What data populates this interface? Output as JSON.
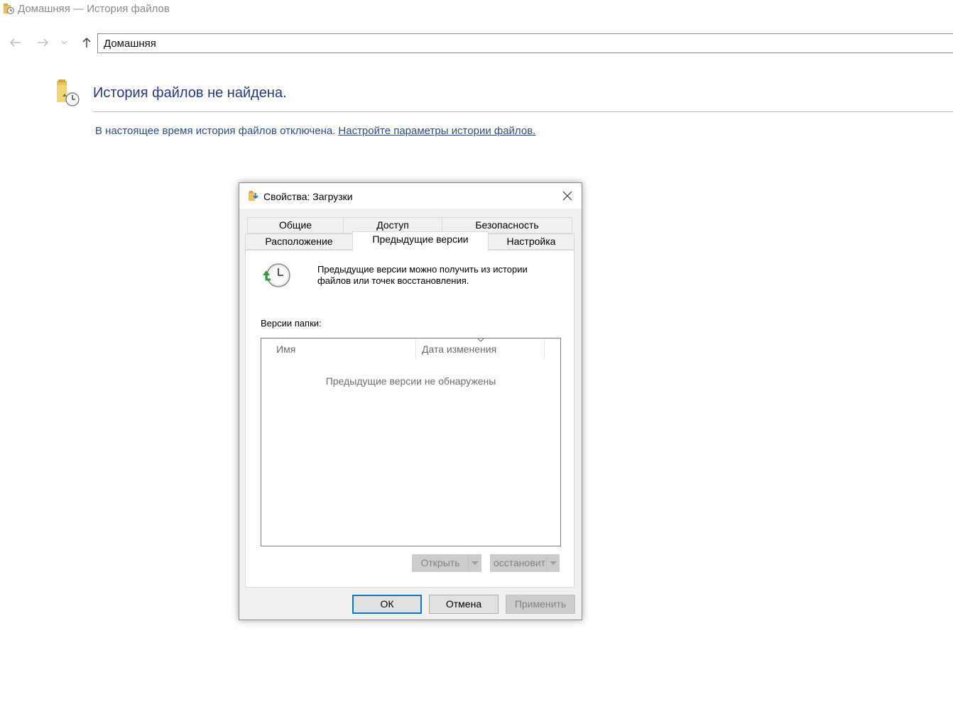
{
  "window": {
    "title": "Домашняя — История файлов"
  },
  "nav": {
    "address": "Домашняя"
  },
  "main": {
    "heading": "История файлов не найдена.",
    "info_text": "В настоящее время история файлов отключена.",
    "settings_link": "Настройте параметры истории файлов."
  },
  "dialog": {
    "title": "Свойства: Загрузки",
    "tabs_row1": [
      "Общие",
      "Доступ",
      "Безопасность"
    ],
    "tabs_row2": [
      "Расположение",
      "Предыдущие версии",
      "Настройка"
    ],
    "active_tab": "Предыдущие версии",
    "description": "Предыдущие версии можно получить из истории файлов или точек восстановления.",
    "versions_label": "Версии папки:",
    "columns": [
      "Имя",
      "Дата изменения"
    ],
    "empty_message": "Предыдущие версии не обнаружены",
    "open_button": "Открыть",
    "restore_button": "осстановит",
    "ok_button": "ОК",
    "cancel_button": "Отмена",
    "apply_button": "Применить"
  },
  "colors": {
    "heading": "#1e3a8a",
    "link": "#2a4d8f",
    "ok_border": "#0078d7"
  }
}
